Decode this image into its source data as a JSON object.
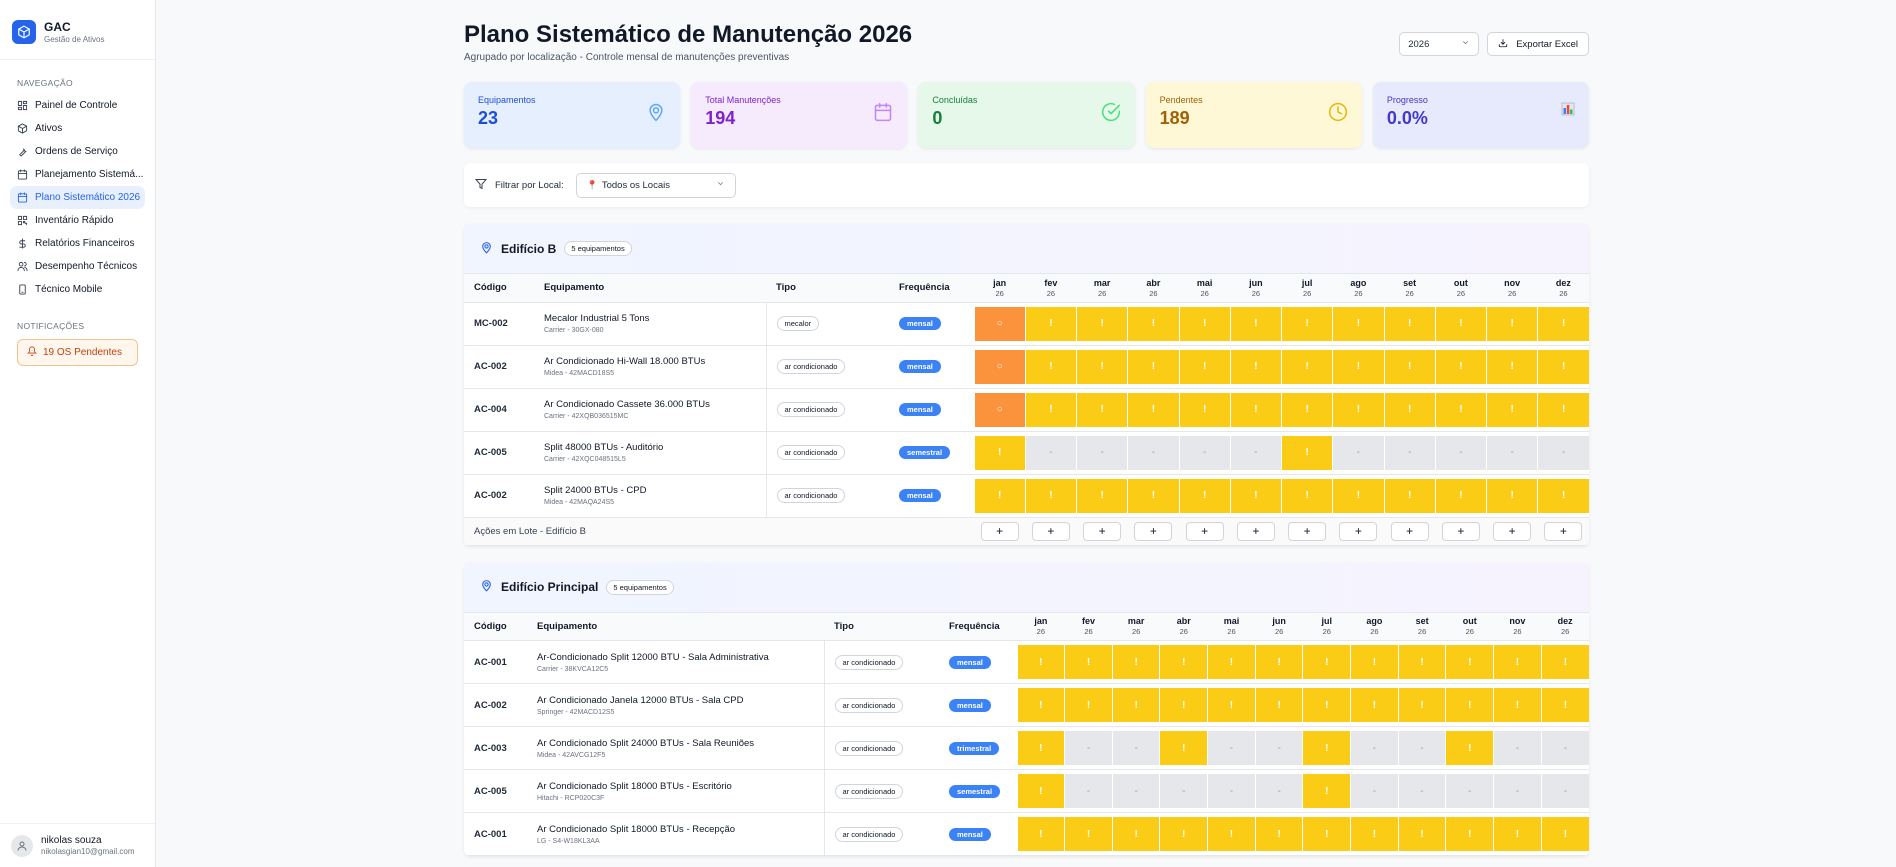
{
  "app": {
    "name": "GAC",
    "subtitle": "Gestão de Ativos"
  },
  "sidebar": {
    "nav_label": "NAVEGAÇÃO",
    "items": [
      {
        "label": "Painel de Controle",
        "icon": "dashboard-icon",
        "active": false
      },
      {
        "label": "Ativos",
        "icon": "box-icon",
        "active": false
      },
      {
        "label": "Ordens de Serviço",
        "icon": "wrench-icon",
        "active": false
      },
      {
        "label": "Planejamento Sistemá...",
        "icon": "calendar-icon",
        "active": false
      },
      {
        "label": "Plano Sistemático 2026",
        "icon": "calendar-check-icon",
        "active": true
      },
      {
        "label": "Inventário Rápido",
        "icon": "qr-code-icon",
        "active": false
      },
      {
        "label": "Relatórios Financeiros",
        "icon": "dollar-icon",
        "active": false
      },
      {
        "label": "Desempenho Técnicos",
        "icon": "users-icon",
        "active": false
      },
      {
        "label": "Técnico Mobile",
        "icon": "mobile-icon",
        "active": false
      }
    ],
    "notif_label": "NOTIFICAÇÕES",
    "notif_text": "19 OS Pendentes",
    "user": {
      "name": "nikolas souza",
      "email": "nikolasgian10@gmail.com"
    }
  },
  "header": {
    "title": "Plano Sistemático de Manutenção 2026",
    "subtitle": "Agrupado por localização - Controle mensal de manutenções preventivas",
    "year": "2026",
    "export_label": "Exportar Excel"
  },
  "stats": [
    {
      "label": "Equipamentos",
      "value": "23",
      "icon": "map-pin-icon",
      "bg": "#e6effd",
      "fg": "#1d4ed8",
      "icon_color": "#60a5fa"
    },
    {
      "label": "Total Manutenções",
      "value": "194",
      "icon": "calendar-icon",
      "bg": "#f5ebfd",
      "fg": "#7e22ce",
      "icon_color": "#c084fc"
    },
    {
      "label": "Concluídas",
      "value": "0",
      "icon": "check-circle-icon",
      "bg": "#e5f8ea",
      "fg": "#15803d",
      "icon_color": "#4ade80"
    },
    {
      "label": "Pendentes",
      "value": "189",
      "icon": "clock-icon",
      "bg": "#fef8d6",
      "fg": "#a16207",
      "icon_color": "#eab308"
    },
    {
      "label": "Progresso",
      "value": "0.0%",
      "icon": "bar-chart-icon",
      "bg": "#e6eafc",
      "fg": "#4338ca",
      "icon_color": "#6366f1"
    }
  ],
  "filter": {
    "label": "Filtrar por Local:",
    "value": "Todos os Locais"
  },
  "columns": {
    "code": "Código",
    "equipment": "Equipamento",
    "type": "Tipo",
    "frequency": "Frequência"
  },
  "months": [
    "jan",
    "fev",
    "mar",
    "abr",
    "mai",
    "jun",
    "jul",
    "ago",
    "set",
    "out",
    "nov",
    "dez"
  ],
  "month_year": "26",
  "symbols": {
    "pending": "!",
    "overdue": "○",
    "none": "-",
    "add": "+"
  },
  "locations": [
    {
      "name": "Edifício B",
      "count": "5 equipamentos",
      "batch_label": "Ações em Lote - Edifício B",
      "rows": [
        {
          "code": "MC-002",
          "name": "Mecalor Industrial 5 Tons",
          "sub": "Carrier - 30GX-080",
          "type": "mecalor",
          "freq": "mensal",
          "months": [
            "overdue",
            "pending",
            "pending",
            "pending",
            "pending",
            "pending",
            "pending",
            "pending",
            "pending",
            "pending",
            "pending",
            "pending"
          ]
        },
        {
          "code": "AC-002",
          "name": "Ar Condicionado Hi-Wall 18.000 BTUs",
          "sub": "Midea - 42MACD18S5",
          "type": "ar condicionado",
          "freq": "mensal",
          "months": [
            "overdue",
            "pending",
            "pending",
            "pending",
            "pending",
            "pending",
            "pending",
            "pending",
            "pending",
            "pending",
            "pending",
            "pending"
          ]
        },
        {
          "code": "AC-004",
          "name": "Ar Condicionado Cassete 36.000 BTUs",
          "sub": "Carrier - 42XQB036515MC",
          "type": "ar condicionado",
          "freq": "mensal",
          "months": [
            "overdue",
            "pending",
            "pending",
            "pending",
            "pending",
            "pending",
            "pending",
            "pending",
            "pending",
            "pending",
            "pending",
            "pending"
          ]
        },
        {
          "code": "AC-005",
          "name": "Split 48000 BTUs - Auditório",
          "sub": "Carrier - 42XQC048515L5",
          "type": "ar condicionado",
          "freq": "semestral",
          "months": [
            "pending",
            "none",
            "none",
            "none",
            "none",
            "none",
            "pending",
            "none",
            "none",
            "none",
            "none",
            "none"
          ]
        },
        {
          "code": "AC-002",
          "name": "Split 24000 BTUs - CPD",
          "sub": "Midea - 42MAQA24S5",
          "type": "ar condicionado",
          "freq": "mensal",
          "months": [
            "pending",
            "pending",
            "pending",
            "pending",
            "pending",
            "pending",
            "pending",
            "pending",
            "pending",
            "pending",
            "pending",
            "pending"
          ]
        }
      ]
    },
    {
      "name": "Edifício Principal",
      "count": "5 equipamentos",
      "batch_label": "",
      "rows": [
        {
          "code": "AC-001",
          "name": "Ar-Condicionado Split 12000 BTU - Sala Administrativa",
          "sub": "Carrier - 38KVCA12C5",
          "type": "ar condicionado",
          "freq": "mensal",
          "months": [
            "pending",
            "pending",
            "pending",
            "pending",
            "pending",
            "pending",
            "pending",
            "pending",
            "pending",
            "pending",
            "pending",
            "pending"
          ]
        },
        {
          "code": "AC-002",
          "name": "Ar Condicionado Janela 12000 BTUs - Sala CPD",
          "sub": "Springer - 42MACD12S5",
          "type": "ar condicionado",
          "freq": "mensal",
          "months": [
            "pending",
            "pending",
            "pending",
            "pending",
            "pending",
            "pending",
            "pending",
            "pending",
            "pending",
            "pending",
            "pending",
            "pending"
          ]
        },
        {
          "code": "AC-003",
          "name": "Ar Condicionado Split 24000 BTUs - Sala Reuniões",
          "sub": "Midea - 42AVCG12F5",
          "type": "ar condicionado",
          "freq": "trimestral",
          "months": [
            "pending",
            "none",
            "none",
            "pending",
            "none",
            "none",
            "pending",
            "none",
            "none",
            "pending",
            "none",
            "none"
          ]
        },
        {
          "code": "AC-005",
          "name": "Ar Condicionado Split 18000 BTUs - Escritório",
          "sub": "Hitachi - RCP020C3F",
          "type": "ar condicionado",
          "freq": "semestral",
          "months": [
            "pending",
            "none",
            "none",
            "none",
            "none",
            "none",
            "pending",
            "none",
            "none",
            "none",
            "none",
            "none"
          ]
        },
        {
          "code": "AC-001",
          "name": "Ar Condicionado Split 18000 BTUs - Recepção",
          "sub": "LG - S4-W18KL3AA",
          "type": "ar condicionado",
          "freq": "mensal",
          "months": [
            "pending",
            "pending",
            "pending",
            "pending",
            "pending",
            "pending",
            "pending",
            "pending",
            "pending",
            "pending",
            "pending",
            "pending"
          ]
        }
      ]
    }
  ]
}
